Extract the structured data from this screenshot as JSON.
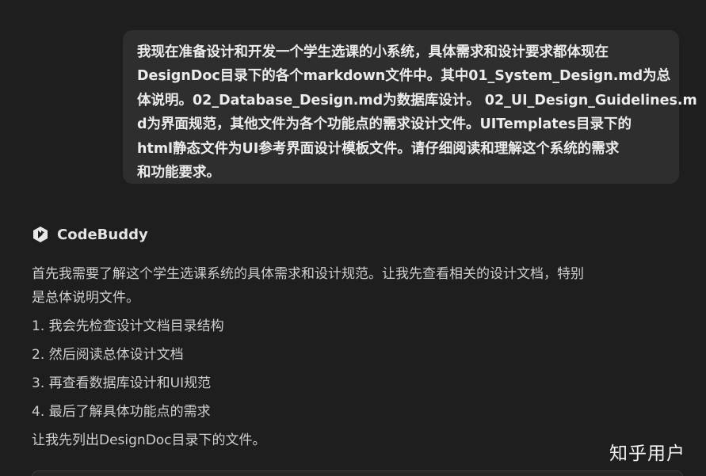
{
  "user_message": {
    "lines": [
      "我现在准备设计和开发一个学生选课的小系统，具体需求和设计要求都体现在",
      "DesignDoc目录下的各个markdown文件中。其中01_System_Design.md为总",
      "体说明。02_Database_Design.md为数据库设计。 02_UI_Design_Guidelines.md",
      "d为界面规范，其他文件为各个功能点的需求设计文件。UITemplates目录下的",
      "html静态文件为UI参考界面设计模板文件。请仔细阅读和理解这个系统的需求",
      "和功能要求。"
    ]
  },
  "assistant": {
    "name": "CodeBuddy",
    "logo_icon": "codebuddy-logo-icon",
    "intro_lines": [
      "首先我需要了解这个学生选课系统的具体需求和设计规范。让我先查看相关的设计文档，特别",
      "是总体说明文件。"
    ],
    "steps": [
      "1. 我会先检查设计文档目录结构",
      "2. 然后阅读总体设计文档",
      "3. 再查看数据库设计和UI规范",
      "4. 最后了解具体功能点的需求"
    ],
    "closing": "让我先列出DesignDoc目录下的文件。"
  },
  "watermark": "知乎用户",
  "colors": {
    "background": "#1e1e1e",
    "user_bubble": "#2e2e2e",
    "text": "#cfcfcf"
  }
}
